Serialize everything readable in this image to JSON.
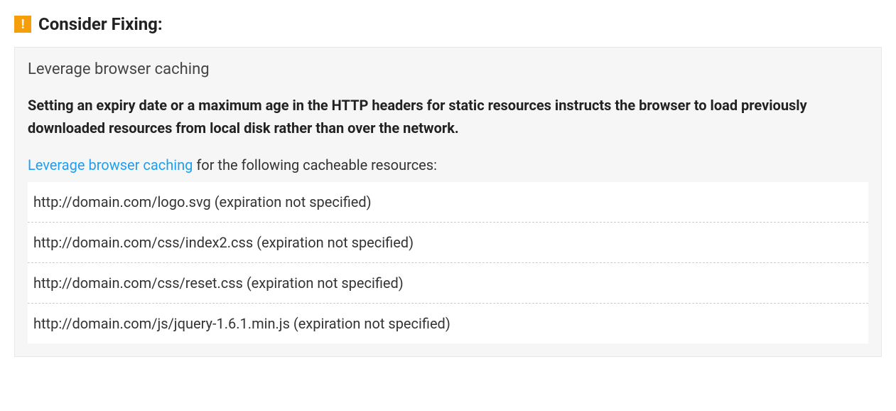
{
  "header": {
    "title": "Consider Fixing:"
  },
  "rule": {
    "title": "Leverage browser caching",
    "description": "Setting an expiry date or a maximum age in the HTTP headers for static resources instructs the browser to load previously downloaded resources from local disk rather than over the network.",
    "link_text": "Leverage browser caching",
    "following_text": " for the following cacheable resources:",
    "resources": [
      "http://domain.com/logo.svg (expiration not specified)",
      "http://domain.com/css/index2.css (expiration not specified)",
      "http://domain.com/css/reset.css (expiration not specified)",
      "http://domain.com/js/jquery-1.6.1.min.js (expiration not specified)"
    ]
  },
  "colors": {
    "warn": "#f59e0b",
    "link": "#1ca0f2"
  }
}
